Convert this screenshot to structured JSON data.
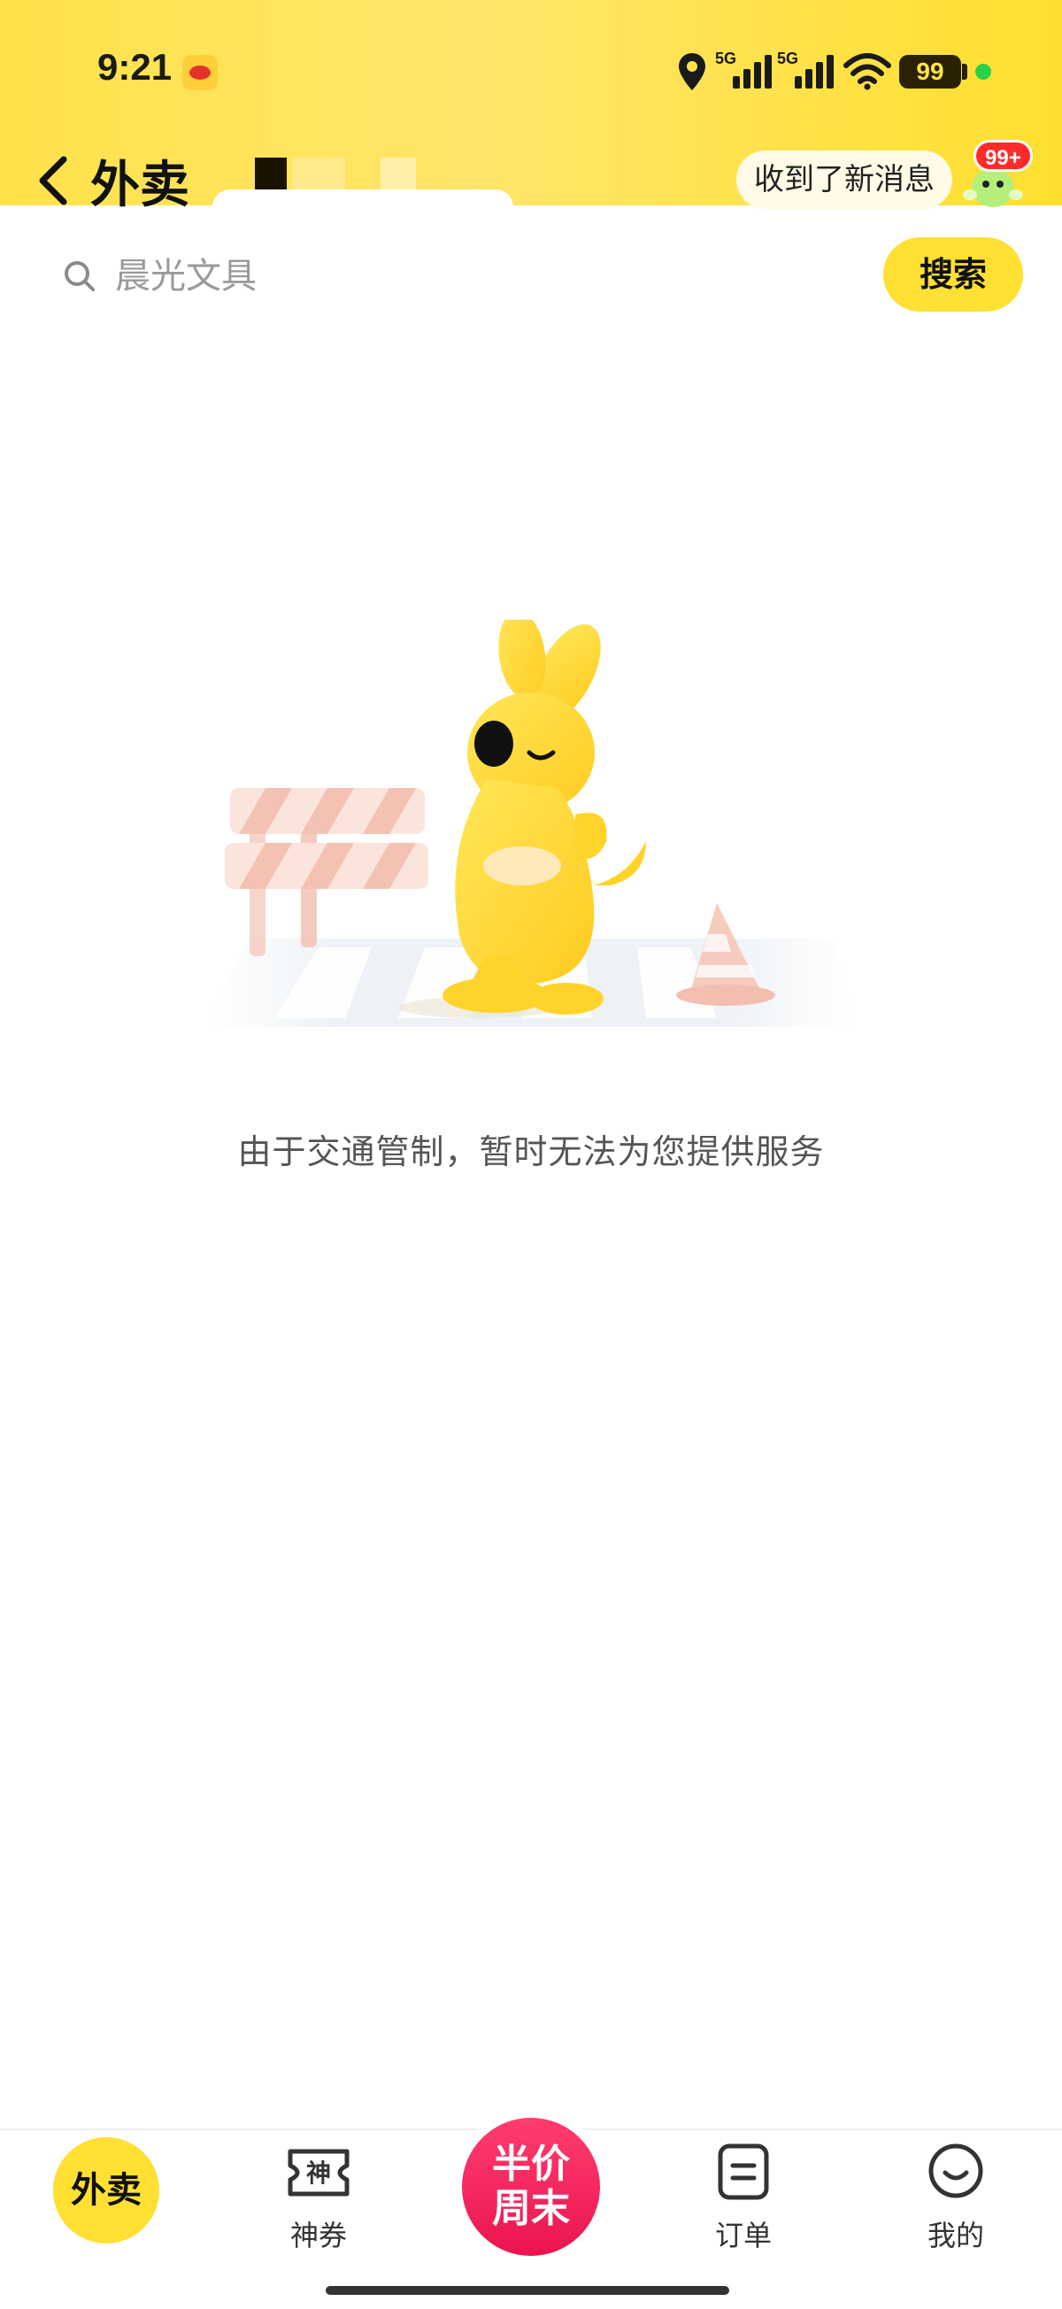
{
  "status_bar": {
    "time": "9:21",
    "signal1_label": "5G",
    "signal2_label": "5G",
    "battery": "99",
    "icons": [
      "weibo-icon",
      "location-icon",
      "signal-icon",
      "wifi-icon",
      "battery-icon"
    ]
  },
  "header": {
    "back_icon": "chevron-left-icon",
    "title": "外卖",
    "message_bubble": "收到了新消息",
    "badge": "99+"
  },
  "search": {
    "placeholder": "晨光文具",
    "button_label": "搜索"
  },
  "main": {
    "message": "由于交通管制，暂时无法为您提供服务"
  },
  "bottom_nav": {
    "items": [
      {
        "label": "外卖",
        "icon": "waimai-icon"
      },
      {
        "label": "神券",
        "icon": "coupon-icon"
      },
      {
        "label": "半价周末",
        "line1": "半价",
        "line2": "周末",
        "icon": "half-price-icon"
      },
      {
        "label": "订单",
        "icon": "orders-icon"
      },
      {
        "label": "我的",
        "icon": "profile-icon"
      }
    ]
  },
  "colors": {
    "brand_yellow": "#ffe033",
    "promo_red": "#ea1450",
    "badge_red": "#ff2a2a"
  }
}
